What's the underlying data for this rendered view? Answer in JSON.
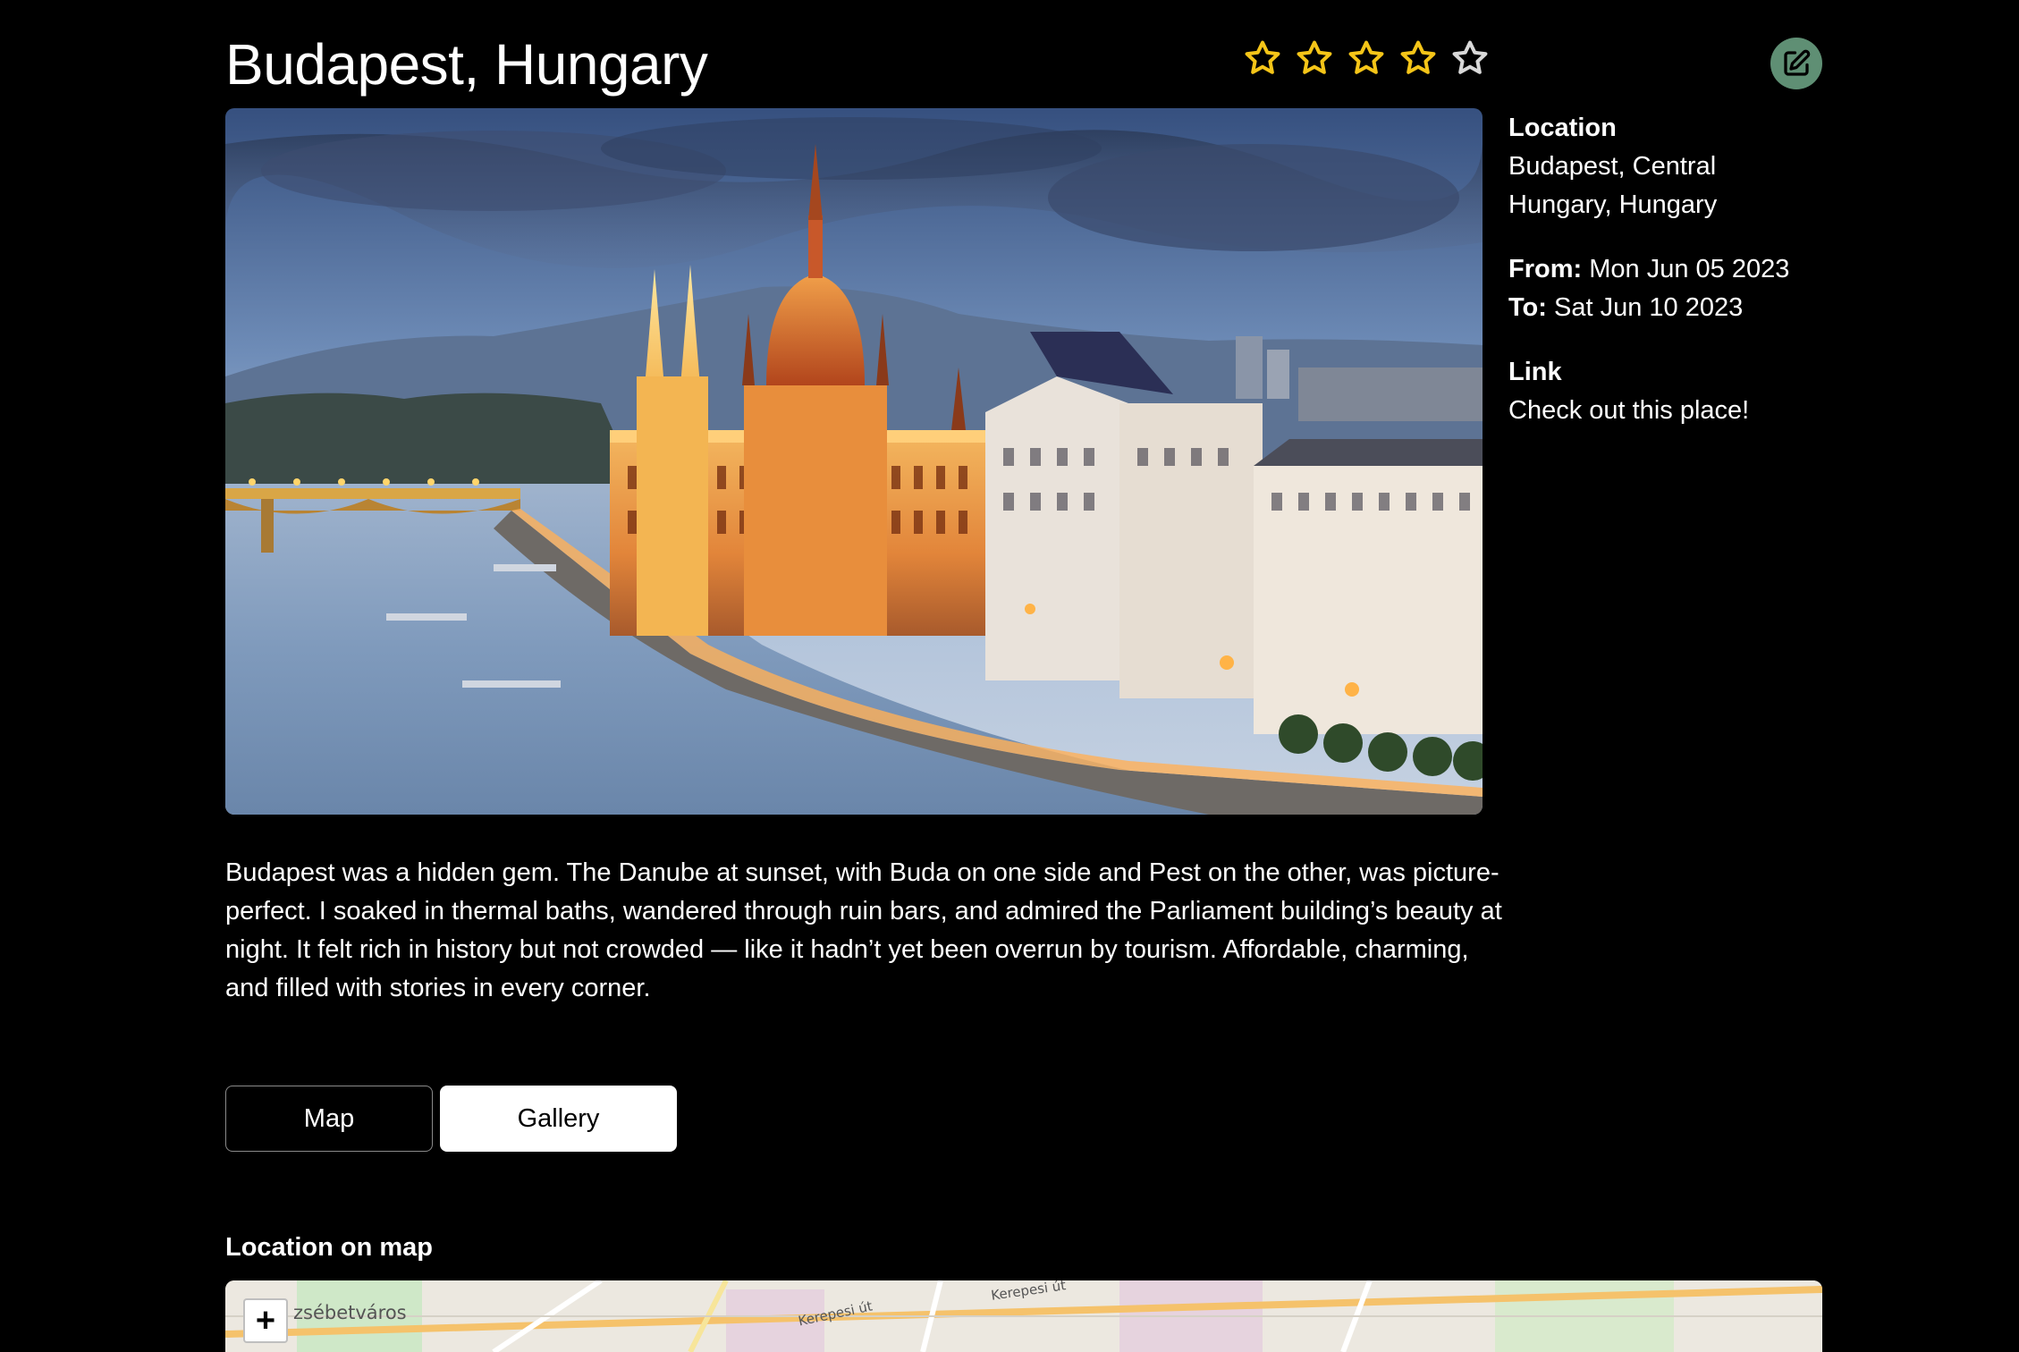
{
  "trip": {
    "title": "Budapest, Hungary",
    "rating": 4,
    "max_rating": 5
  },
  "colors": {
    "star_filled": "#f5c518",
    "star_empty": "#d9d9d9",
    "edit_button_bg": "#5f8f74",
    "background": "#000000"
  },
  "icons": {
    "edit": "edit-square-pen-icon",
    "star": "star-icon"
  },
  "details": {
    "location_label": "Location",
    "location_value": "Budapest, Central Hungary, Hungary",
    "from_label": "From:",
    "from_value": "Mon Jun 05 2023",
    "to_label": "To:",
    "to_value": "Sat Jun 10 2023",
    "link_label": "Link",
    "link_text": "Check out this place!"
  },
  "description": "Budapest was a hidden gem. The Danube at sunset, with Buda on one side and Pest on the other, was picture-perfect. I soaked in thermal baths, wandered through ruin bars, and admired the Parliament building’s beauty at night. It felt rich in history but not crowded — like it hadn’t yet been overrun by tourism. Affordable, charming, and filled with stories in every corner.",
  "tabs": [
    {
      "label": "Map",
      "active": false
    },
    {
      "label": "Gallery",
      "active": true
    }
  ],
  "map": {
    "heading": "Location on map",
    "zoom_in_label": "+",
    "district_label": "zsébetváros",
    "street_labels": [
      "Kerepesi út",
      "Kerepesi út"
    ]
  }
}
